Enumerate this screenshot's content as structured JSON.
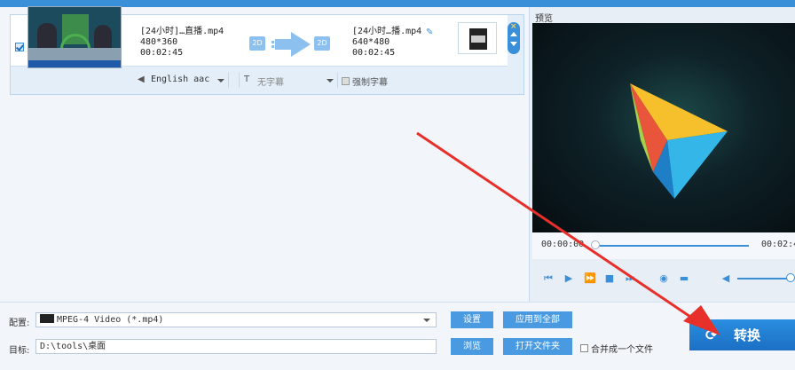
{
  "file": {
    "checked": true,
    "source": {
      "name": "[24小时]…直播.mp4",
      "resolution": "480*360",
      "duration": "00:02:45",
      "dim": "2D"
    },
    "output": {
      "name": "[24小时…播.mp4",
      "resolution": "640*480",
      "duration": "00:02:45",
      "dim": "2D"
    },
    "format_icon": "mpeg-film-icon",
    "audio_track": "English aac",
    "subtitle": "无字幕",
    "force_subtitle": "强制字幕"
  },
  "preview": {
    "label": "预览",
    "time_current": "00:00:00",
    "time_total": "00:02:4"
  },
  "bottom": {
    "profile_label": "配置:",
    "profile_value": "MPEG-4 Video (*.mp4)",
    "settings_button": "设置",
    "apply_all_button": "应用到全部",
    "target_label": "目标:",
    "target_value": "D:\\tools\\桌面",
    "browse_button": "浏览",
    "open_folder_button": "打开文件夹",
    "merge_label": "合并成一个文件",
    "convert_button": "转换"
  },
  "colors": {
    "accent": "#3a8fd9",
    "button": "#4a9ae2",
    "annotation_arrow": "#e8302a"
  }
}
